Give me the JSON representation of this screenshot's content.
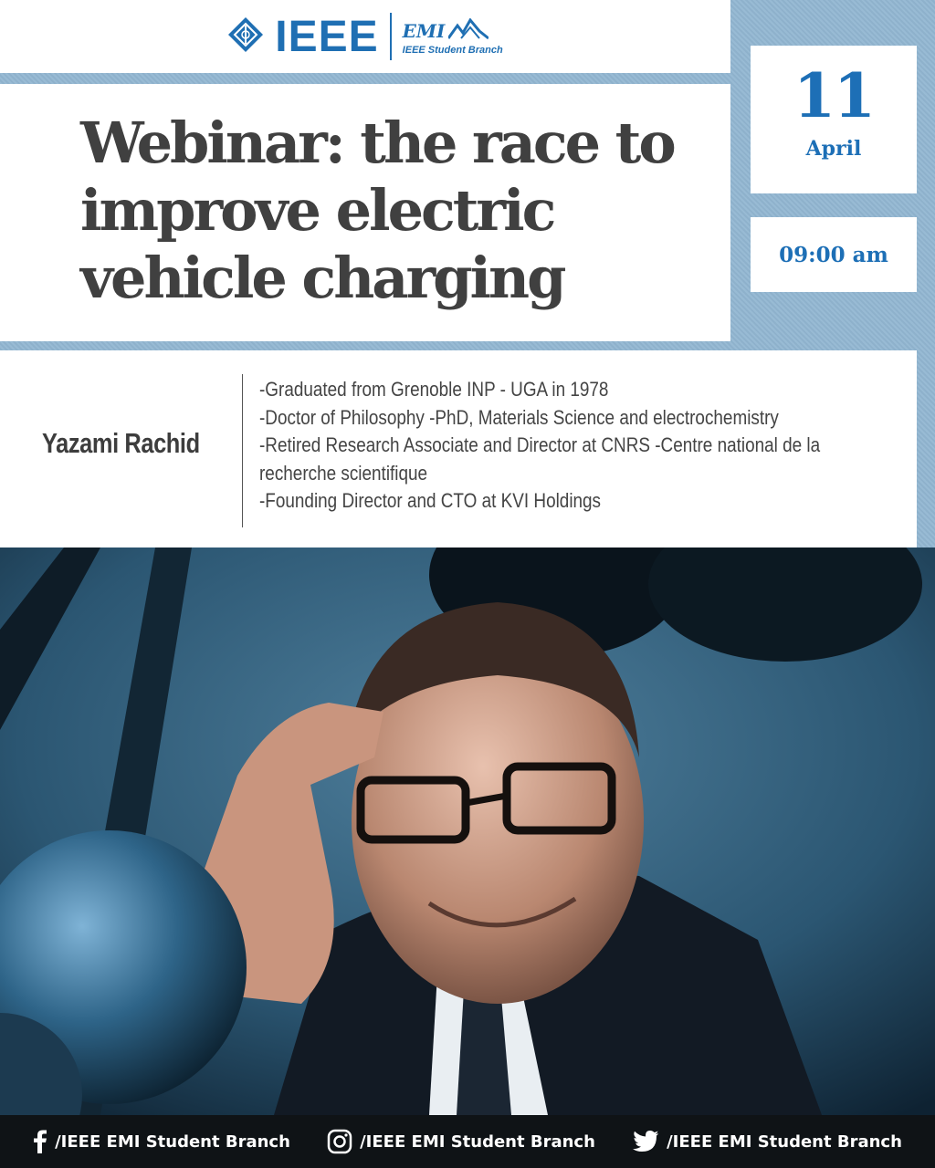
{
  "header": {
    "org_name": "IEEE",
    "branch_mark": "EMI",
    "branch_name": "IEEE Student Branch"
  },
  "title": "Webinar: the race to improve electric vehicle charging",
  "event": {
    "day": "11",
    "month": "April",
    "time": "09:00 am"
  },
  "speaker": {
    "name": "Yazami Rachid",
    "bio": [
      "-Graduated from Grenoble INP - UGA in 1978",
      "-Doctor of Philosophy -PhD, Materials Science and electrochemistry",
      "-Retired Research Associate and Director at CNRS -Centre national de la recherche scientifique",
      "-Founding Director and CTO at KVI Holdings"
    ]
  },
  "footer": {
    "facebook": "/IEEE EMI Student Branch",
    "instagram": "/IEEE EMI Student Branch",
    "twitter": "/IEEE EMI Student Branch"
  },
  "colors": {
    "brand_blue": "#1d6fb6",
    "background_blue": "#93b7d2",
    "title_gray": "#404040",
    "footer_bg": "#0f1316"
  },
  "icons": [
    "ieee-diamond-icon",
    "emi-mountain-icon",
    "facebook-icon",
    "instagram-icon",
    "twitter-icon"
  ]
}
